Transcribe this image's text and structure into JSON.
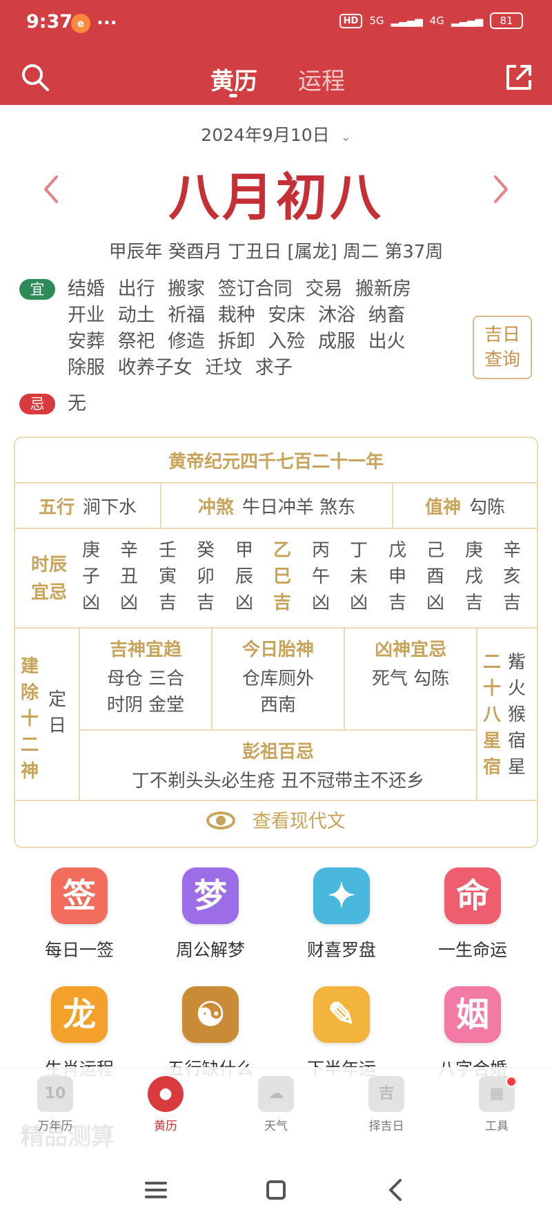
{
  "status": {
    "time": "9:37",
    "app_badge": "e",
    "more": "...",
    "hd": "HD",
    "network_1": "5G",
    "network_2": "4G",
    "battery": "81"
  },
  "header": {
    "tabs": [
      {
        "label": "黄历",
        "active": true
      },
      {
        "label": "运程",
        "active": false
      }
    ],
    "icons": [
      "search-icon",
      "share-icon"
    ]
  },
  "date": {
    "solar": "2024年9月10日",
    "lunar": "八月初八",
    "ganzhi": "甲辰年 癸酉月 丁丑日 [属龙] 周二 第37周"
  },
  "yi": {
    "badge": "宜",
    "items": [
      "结婚",
      "出行",
      "搬家",
      "签订合同",
      "交易",
      "搬新房",
      "开业",
      "动土",
      "祈福",
      "栽种",
      "安床",
      "沐浴",
      "纳畜",
      "安葬",
      "祭祀",
      "修造",
      "拆卸",
      "入殓",
      "成服",
      "出火",
      "除服",
      "收养子女",
      "迁坟",
      "求子"
    ]
  },
  "ji": {
    "badge": "忌",
    "items": [
      "无"
    ]
  },
  "lucky_button": {
    "line1": "吉日",
    "line2": "查询"
  },
  "almanac": {
    "era": "黄帝纪元四千七百二十一年",
    "wuxing": {
      "label": "五行",
      "value": "涧下水"
    },
    "chongsha": {
      "label": "冲煞",
      "value": "牛日冲羊 煞东"
    },
    "zhishen": {
      "label": "值神",
      "value": "勾陈"
    },
    "shichen": {
      "label_line1": "时辰",
      "label_line2": "宜忌",
      "columns": [
        {
          "stem": "庚",
          "branch": "子",
          "result": "凶",
          "current": false
        },
        {
          "stem": "辛",
          "branch": "丑",
          "result": "凶",
          "current": false
        },
        {
          "stem": "壬",
          "branch": "寅",
          "result": "吉",
          "current": false
        },
        {
          "stem": "癸",
          "branch": "卯",
          "result": "吉",
          "current": false
        },
        {
          "stem": "甲",
          "branch": "辰",
          "result": "凶",
          "current": false
        },
        {
          "stem": "乙",
          "branch": "巳",
          "result": "吉",
          "current": true
        },
        {
          "stem": "丙",
          "branch": "午",
          "result": "凶",
          "current": false
        },
        {
          "stem": "丁",
          "branch": "未",
          "result": "凶",
          "current": false
        },
        {
          "stem": "戊",
          "branch": "申",
          "result": "吉",
          "current": false
        },
        {
          "stem": "己",
          "branch": "酉",
          "result": "凶",
          "current": false
        },
        {
          "stem": "庚",
          "branch": "戌",
          "result": "吉",
          "current": false
        },
        {
          "stem": "辛",
          "branch": "亥",
          "result": "吉",
          "current": false
        }
      ]
    },
    "jianchu": {
      "title": "建除十二神",
      "value": "定日"
    },
    "jishen": {
      "title": "吉神宜趋",
      "line1": "母仓 三合",
      "line2": "时阴 金堂"
    },
    "taishen": {
      "title": "今日胎神",
      "line1": "仓库厕外",
      "line2": "西南"
    },
    "xiongshen": {
      "title": "凶神宜忌",
      "line1": "死气 勾陈"
    },
    "xingxiu": {
      "title": "二十八星宿",
      "value": "觜火猴宿星"
    },
    "pengzu": {
      "title": "彭祖百忌",
      "text": "丁不剃头头必生疮 丑不冠带主不还乡"
    },
    "modern_text": "查看现代文"
  },
  "tools": [
    {
      "glyph": "签",
      "label": "每日一签",
      "color": "#f26d5b"
    },
    {
      "glyph": "梦",
      "label": "周公解梦",
      "color": "#9b6ee8"
    },
    {
      "glyph": "✦",
      "label": "财喜罗盘",
      "color": "#48b9dd"
    },
    {
      "glyph": "命",
      "label": "一生命运",
      "color": "#ef5e6e"
    },
    {
      "glyph": "龙",
      "label": "生肖运程",
      "color": "#f4a12c"
    },
    {
      "glyph": "☯",
      "label": "五行缺什么",
      "color": "#c98b35"
    },
    {
      "glyph": "✎",
      "label": "下半年运",
      "color": "#f3b43e"
    },
    {
      "glyph": "姻",
      "label": "八字合婚",
      "color": "#f37aa4"
    }
  ],
  "bottom_nav": [
    {
      "label": "万年历",
      "glyph": "10",
      "active": false
    },
    {
      "label": "黄历",
      "glyph": "●",
      "active": true
    },
    {
      "label": "天气",
      "glyph": "☁",
      "active": false
    },
    {
      "label": "择吉日",
      "glyph": "吉",
      "active": false
    },
    {
      "label": "工具",
      "glyph": "▦",
      "active": false
    }
  ],
  "background_text": "精品测算"
}
